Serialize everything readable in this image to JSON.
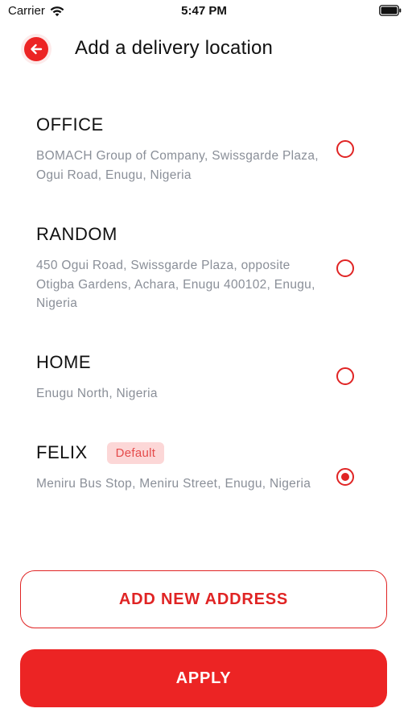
{
  "status_bar": {
    "carrier": "Carrier",
    "time": "5:47 PM",
    "wifi_icon": "wifi-icon",
    "battery_icon": "battery-icon"
  },
  "header": {
    "back_icon": "arrow-left-icon",
    "title": "Add a delivery location"
  },
  "addresses": [
    {
      "name": "OFFICE",
      "address": "BOMACH Group of Company, Swissgarde Plaza, Ogui Road, Enugu, Nigeria",
      "selected": false,
      "badge": ""
    },
    {
      "name": "RANDOM",
      "address": "450 Ogui Road, Swissgarde Plaza, opposite Otigba Gardens, Achara, Enugu 400102, Enugu, Nigeria",
      "selected": false,
      "badge": ""
    },
    {
      "name": "HOME",
      "address": "Enugu North, Nigeria",
      "selected": false,
      "badge": ""
    },
    {
      "name": "FELIX",
      "address": "Meniru Bus Stop, Meniru Street, Enugu, Nigeria",
      "selected": true,
      "badge": "Default"
    }
  ],
  "buttons": {
    "add_new_address": "ADD NEW ADDRESS",
    "apply": "APPLY"
  },
  "colors": {
    "accent": "#EC2424",
    "badge_bg": "#FCD7D7",
    "muted_text": "#8A8F98"
  }
}
